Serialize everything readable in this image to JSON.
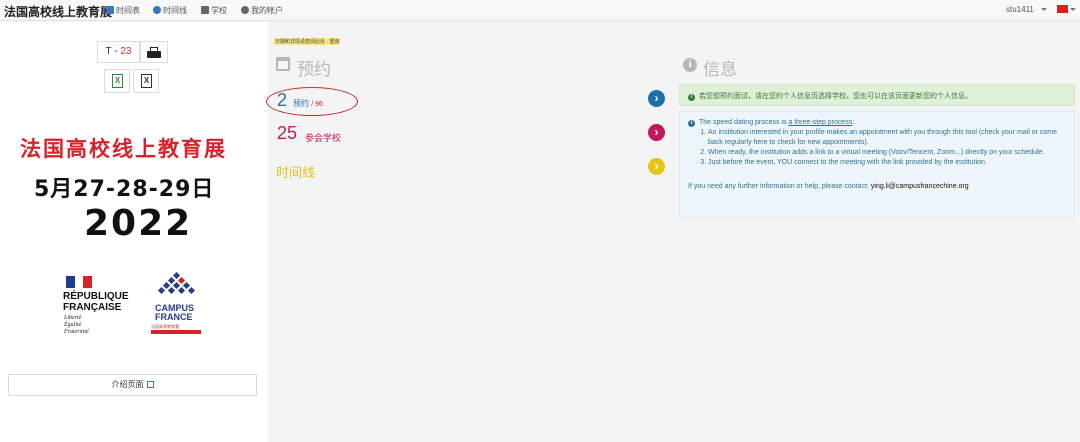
{
  "navbar": {
    "brand": "法国高校线上教育展",
    "items": [
      {
        "label": "时间表",
        "icon": "calendar-icon"
      },
      {
        "label": "时间线",
        "icon": "clock-icon"
      },
      {
        "label": "学校",
        "icon": "users-icon"
      },
      {
        "label": "我的帐户",
        "icon": "user-icon"
      }
    ],
    "user": "stu1411",
    "language_flag": "china-flag-icon"
  },
  "left": {
    "tcode_prefix": "T -",
    "tcode_num": "23",
    "excel_label": "X",
    "fair_title": "法国高校线上教育展",
    "fair_dates": "5月27-28-29日",
    "fair_year": "2022",
    "rf_name_line1": "RÉPUBLIQUE",
    "rf_name_line2": "FRANÇAISE",
    "rf_motto_1": "Liberté",
    "rf_motto_2": "Égalité",
    "rf_motto_3": "Fraternité",
    "cf_line1": "CAMPUS",
    "cf_line2": "FRANCE",
    "cf_sub": "法国高等教育署",
    "intro_link": "介绍页面"
  },
  "middle": {
    "note": "日期和详情请查阅此处 · 重启",
    "appointments_heading": "预约",
    "appointment_count": "2",
    "appointment_label": "预约",
    "appointment_max": "/ 96",
    "schools_count": "25",
    "schools_label": "参会学校",
    "timeline_link": "时间线"
  },
  "right": {
    "info_heading": "信息",
    "green_alert": "若您想预约面试，请在您的个人信息页选择学校。您也可以在该页面更新您的个人信息。",
    "blue_intro_pre": "The speed dating process is ",
    "blue_intro_link": "a three-step process",
    "blue_intro_post": ":",
    "steps": [
      "An institution interested in your profile makes an appointment with you through this tool (check your mail or come back regularly here to check for new appointments).",
      "When ready, the institution adds a link to a virtual meeting (Voov/Tencent, Zoom...) directly on your schedule.",
      "Just before the event, YOU connect to the meeting with the link provided by the institution."
    ],
    "contact_text": "If you need any further information or help, please contact: ",
    "contact_email": "ying.li@campusfrancechine.org"
  },
  "colors": {
    "circle1": "#1f6fa8",
    "circle2": "#c2185b",
    "circle3": "#e6c419",
    "alert_green_bg": "#dff0d8",
    "alert_blue_bg": "#eef6fc"
  }
}
